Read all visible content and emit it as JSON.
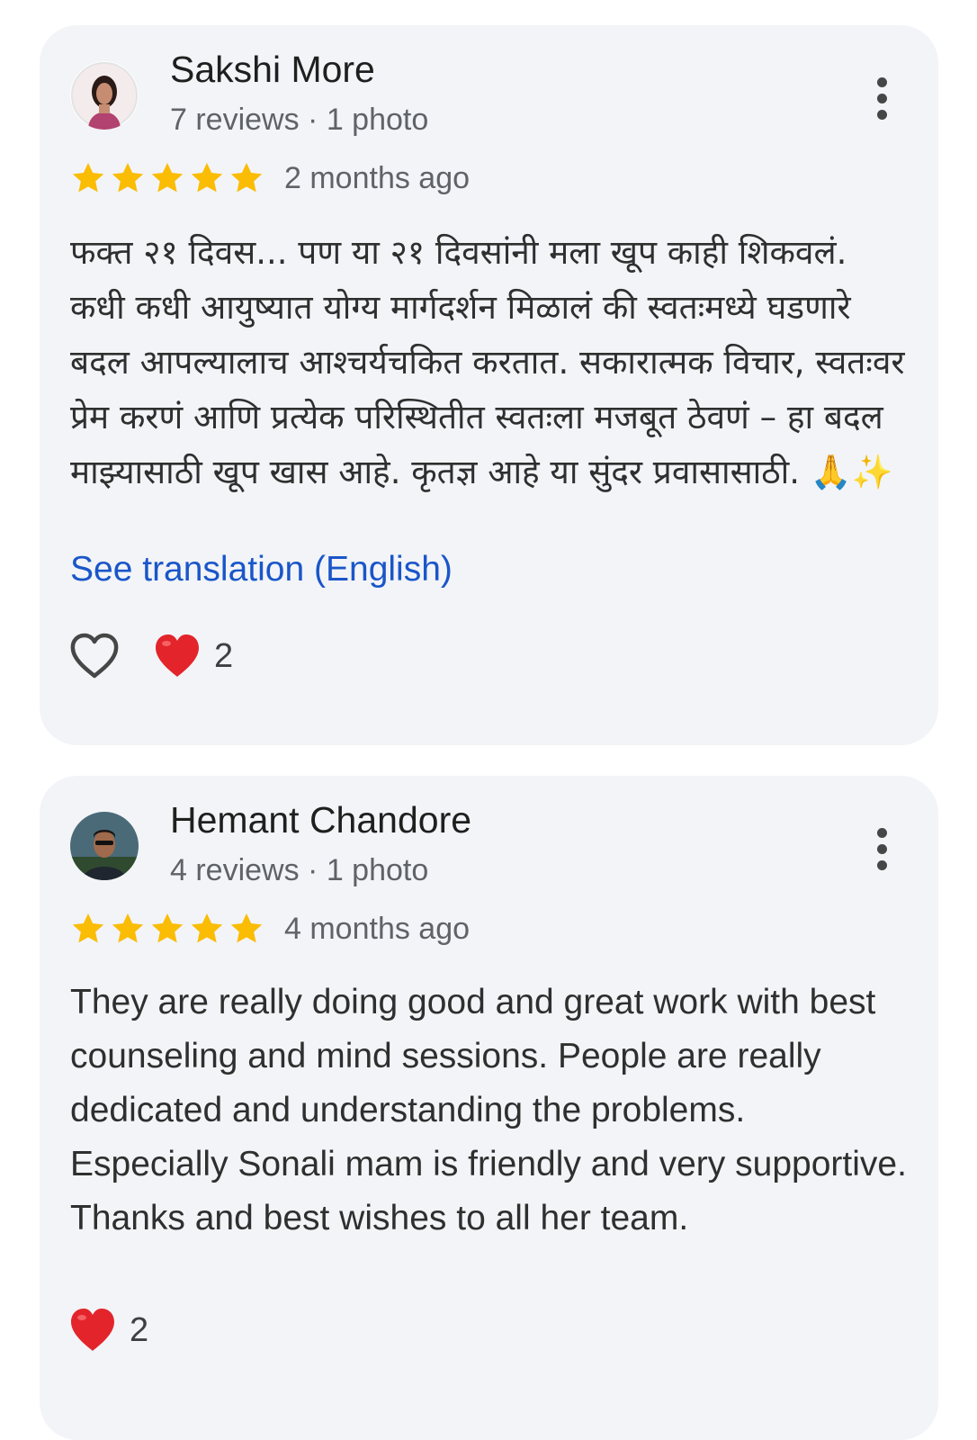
{
  "reviews": [
    {
      "reviewer_name": "Sakshi More",
      "reviewer_meta": "7 reviews · 1 photo",
      "rating": 5,
      "date": "2 months ago",
      "text": "फक्त २१ दिवस... पण या २१ दिवसांनी मला खूप काही शिकवलं. कधी कधी आयुष्यात योग्य मार्गदर्शन मिळालं की स्वतःमध्ये घडणारे बदल आपल्यालाच आश्चर्यचकित करतात. सकारात्मक विचार, स्वतःवर प्रेम करणं आणि प्रत्येक परिस्थितीत स्वतःला मजबूत ठेवणं – हा बदल माझ्यासाठी खूप खास आहे. कृतज्ञ आहे या सुंदर प्रवासासाठी. 🙏✨",
      "translate_label": "See translation (English)",
      "heart_count": "2"
    },
    {
      "reviewer_name": "Hemant Chandore",
      "reviewer_meta": "4 reviews · 1 photo",
      "rating": 5,
      "date": "4 months ago",
      "text": "They are really doing good and great work with best counseling and mind sessions. People are really dedicated and understanding the problems. Especially Sonali mam is friendly and very supportive. Thanks and best wishes to all her team.",
      "heart_count": "2"
    }
  ],
  "colors": {
    "card_bg": "#f2f4f7",
    "star": "#fbbc04",
    "link": "#1a56c9",
    "heart": "#e3242b"
  }
}
